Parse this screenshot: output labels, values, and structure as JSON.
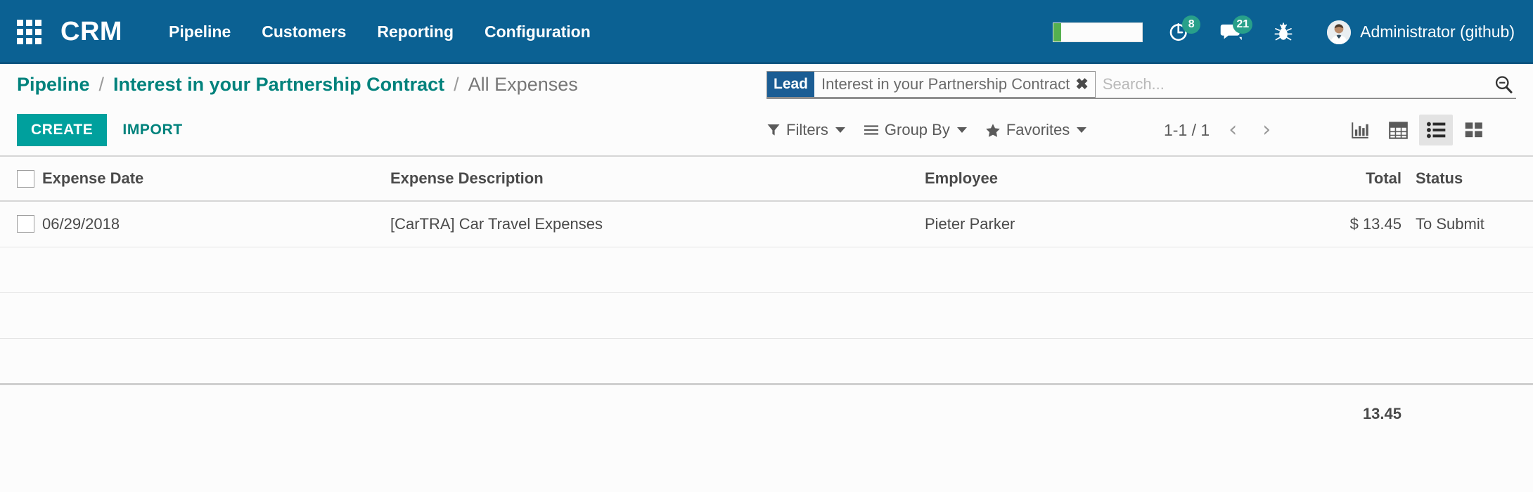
{
  "navbar": {
    "apps_icon": "apps-grid-icon",
    "brand": "CRM",
    "menu": [
      {
        "label": "Pipeline"
      },
      {
        "label": "Customers"
      },
      {
        "label": "Reporting"
      },
      {
        "label": "Configuration"
      }
    ],
    "progress": {
      "name": "progress-bar",
      "percent": 8,
      "fill_color": "#55af4f"
    },
    "activities": {
      "icon": "clock-icon",
      "count": "8"
    },
    "messages": {
      "icon": "chat-bubble-icon",
      "count": "21"
    },
    "debug": {
      "icon": "bug-icon"
    },
    "user": {
      "avatar": "user-avatar",
      "name": "Administrator (github)"
    },
    "background_color": "#0b6193",
    "badge_color": "#28a08a"
  },
  "breadcrumb": {
    "separator": "/",
    "items": [
      {
        "label": "Pipeline",
        "active": true
      },
      {
        "label": "Interest in your Partnership Contract",
        "active": true
      },
      {
        "label": "All Expenses",
        "active": false
      }
    ],
    "link_color": "#00827c"
  },
  "search": {
    "facet": {
      "label": "Lead",
      "value": "Interest in your Partnership Contract",
      "remove_icon": "close-icon",
      "label_color": "#1b5d94"
    },
    "placeholder": "Search...",
    "value": "",
    "search_icon": "search-icon"
  },
  "toolbar": {
    "create_label": "CREATE",
    "import_label": "IMPORT",
    "create_color": "#00a09d",
    "filters": [
      {
        "label": "Filters",
        "icon": "funnel-icon"
      },
      {
        "label": "Group By",
        "icon": "hamburger-icon"
      },
      {
        "label": "Favorites",
        "icon": "star-icon"
      }
    ],
    "pager": {
      "range": "1-1 / 1",
      "prev_icon": "chevron-left-icon",
      "next_icon": "chevron-right-icon"
    },
    "views": [
      {
        "name": "graph-view",
        "icon": "bar-chart-icon",
        "active": false
      },
      {
        "name": "pivot-view",
        "icon": "table-grid-icon",
        "active": false
      },
      {
        "name": "list-view",
        "icon": "list-icon",
        "active": true
      },
      {
        "name": "kanban-view",
        "icon": "kanban-icon",
        "active": false
      }
    ]
  },
  "table": {
    "columns": [
      {
        "key": "date",
        "label": "Expense Date"
      },
      {
        "key": "description",
        "label": "Expense Description"
      },
      {
        "key": "employee",
        "label": "Employee"
      },
      {
        "key": "total",
        "label": "Total"
      },
      {
        "key": "status",
        "label": "Status"
      }
    ],
    "rows": [
      {
        "date": "06/29/2018",
        "description": "[CarTRA] Car Travel Expenses",
        "employee": "Pieter Parker",
        "total": "$ 13.45",
        "status": "To Submit"
      }
    ],
    "empty_row_count": 3,
    "footer": {
      "total": "13.45"
    }
  }
}
